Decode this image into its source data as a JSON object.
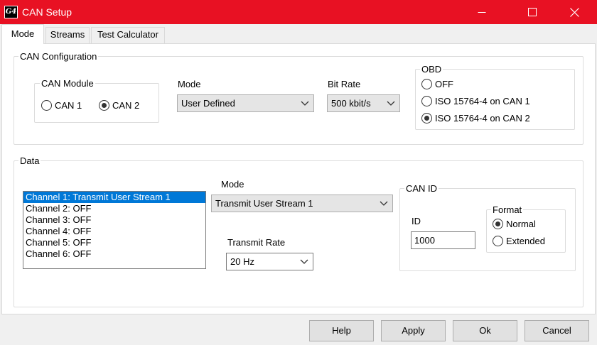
{
  "window": {
    "title": "CAN Setup",
    "icon_text": "G4",
    "accent_color": "#e81123"
  },
  "tabs": [
    {
      "label": "Mode",
      "active": true
    },
    {
      "label": "Streams",
      "active": false
    },
    {
      "label": "Test Calculator",
      "active": false
    }
  ],
  "can_config": {
    "group_label": "CAN Configuration",
    "module": {
      "label": "CAN Module",
      "options": [
        {
          "label": "CAN 1",
          "checked": false
        },
        {
          "label": "CAN 2",
          "checked": true
        }
      ]
    },
    "mode": {
      "label": "Mode",
      "value": "User Defined"
    },
    "bit_rate": {
      "label": "Bit Rate",
      "value": "500 kbit/s"
    },
    "obd": {
      "label": "OBD",
      "options": [
        {
          "label": "OFF",
          "checked": false
        },
        {
          "label": "ISO 15764-4 on CAN 1",
          "checked": false
        },
        {
          "label": "ISO 15764-4 on CAN 2",
          "checked": true
        }
      ]
    }
  },
  "data": {
    "group_label": "Data",
    "channels": [
      {
        "label": "Channel 1: Transmit User Stream 1",
        "selected": true
      },
      {
        "label": "Channel 2: OFF",
        "selected": false
      },
      {
        "label": "Channel 3: OFF",
        "selected": false
      },
      {
        "label": "Channel 4: OFF",
        "selected": false
      },
      {
        "label": "Channel 5: OFF",
        "selected": false
      },
      {
        "label": "Channel 6: OFF",
        "selected": false
      }
    ],
    "mode": {
      "label": "Mode",
      "value": "Transmit User Stream 1"
    },
    "transmit_rate": {
      "label": "Transmit Rate",
      "value": "20 Hz"
    },
    "can_id": {
      "group_label": "CAN ID",
      "id_label": "ID",
      "id_value": "1000",
      "format": {
        "label": "Format",
        "options": [
          {
            "label": "Normal",
            "checked": true
          },
          {
            "label": "Extended",
            "checked": false
          }
        ]
      }
    }
  },
  "buttons": {
    "help": "Help",
    "apply": "Apply",
    "ok": "Ok",
    "cancel": "Cancel"
  },
  "icons": [
    "app-icon",
    "minimize-icon",
    "maximize-icon",
    "close-icon",
    "chevron-down-icon"
  ]
}
